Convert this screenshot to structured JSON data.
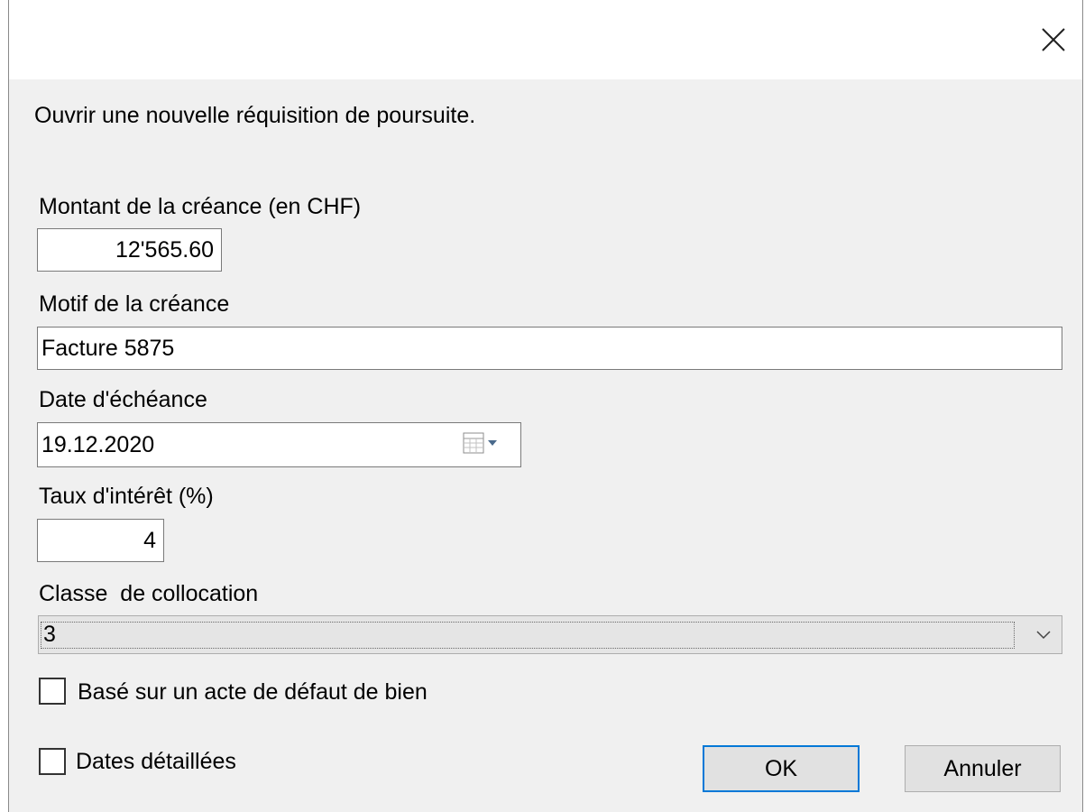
{
  "dialog": {
    "instruction": "Ouvrir une nouvelle réquisition de poursuite.",
    "close_icon": "close-icon"
  },
  "form": {
    "amount_label": "Montant de la créance (en CHF)",
    "amount_value": "12'565.60",
    "motive_label": "Motif de la créance",
    "motive_value": "Facture 5875",
    "due_date_label": "Date d'échéance",
    "due_date_value": "19.12.2020",
    "calendar_icon": "calendar-dropdown-icon",
    "interest_label": "Taux d'intérêt (%)",
    "interest_value": "4",
    "class_label": "Classe  de collocation",
    "class_value": "3",
    "chevron_icon": "chevron-down-icon",
    "checkbox_loss_cert_label": "Basé sur un acte de défaut de bien",
    "checkbox_loss_cert_checked": false,
    "checkbox_detailed_dates_label": "Dates détaillées",
    "checkbox_detailed_dates_checked": false
  },
  "buttons": {
    "ok_label": "OK",
    "cancel_label": "Annuler"
  },
  "colors": {
    "dialog_bg": "#f0f0f0",
    "default_button_border": "#0078d7"
  }
}
